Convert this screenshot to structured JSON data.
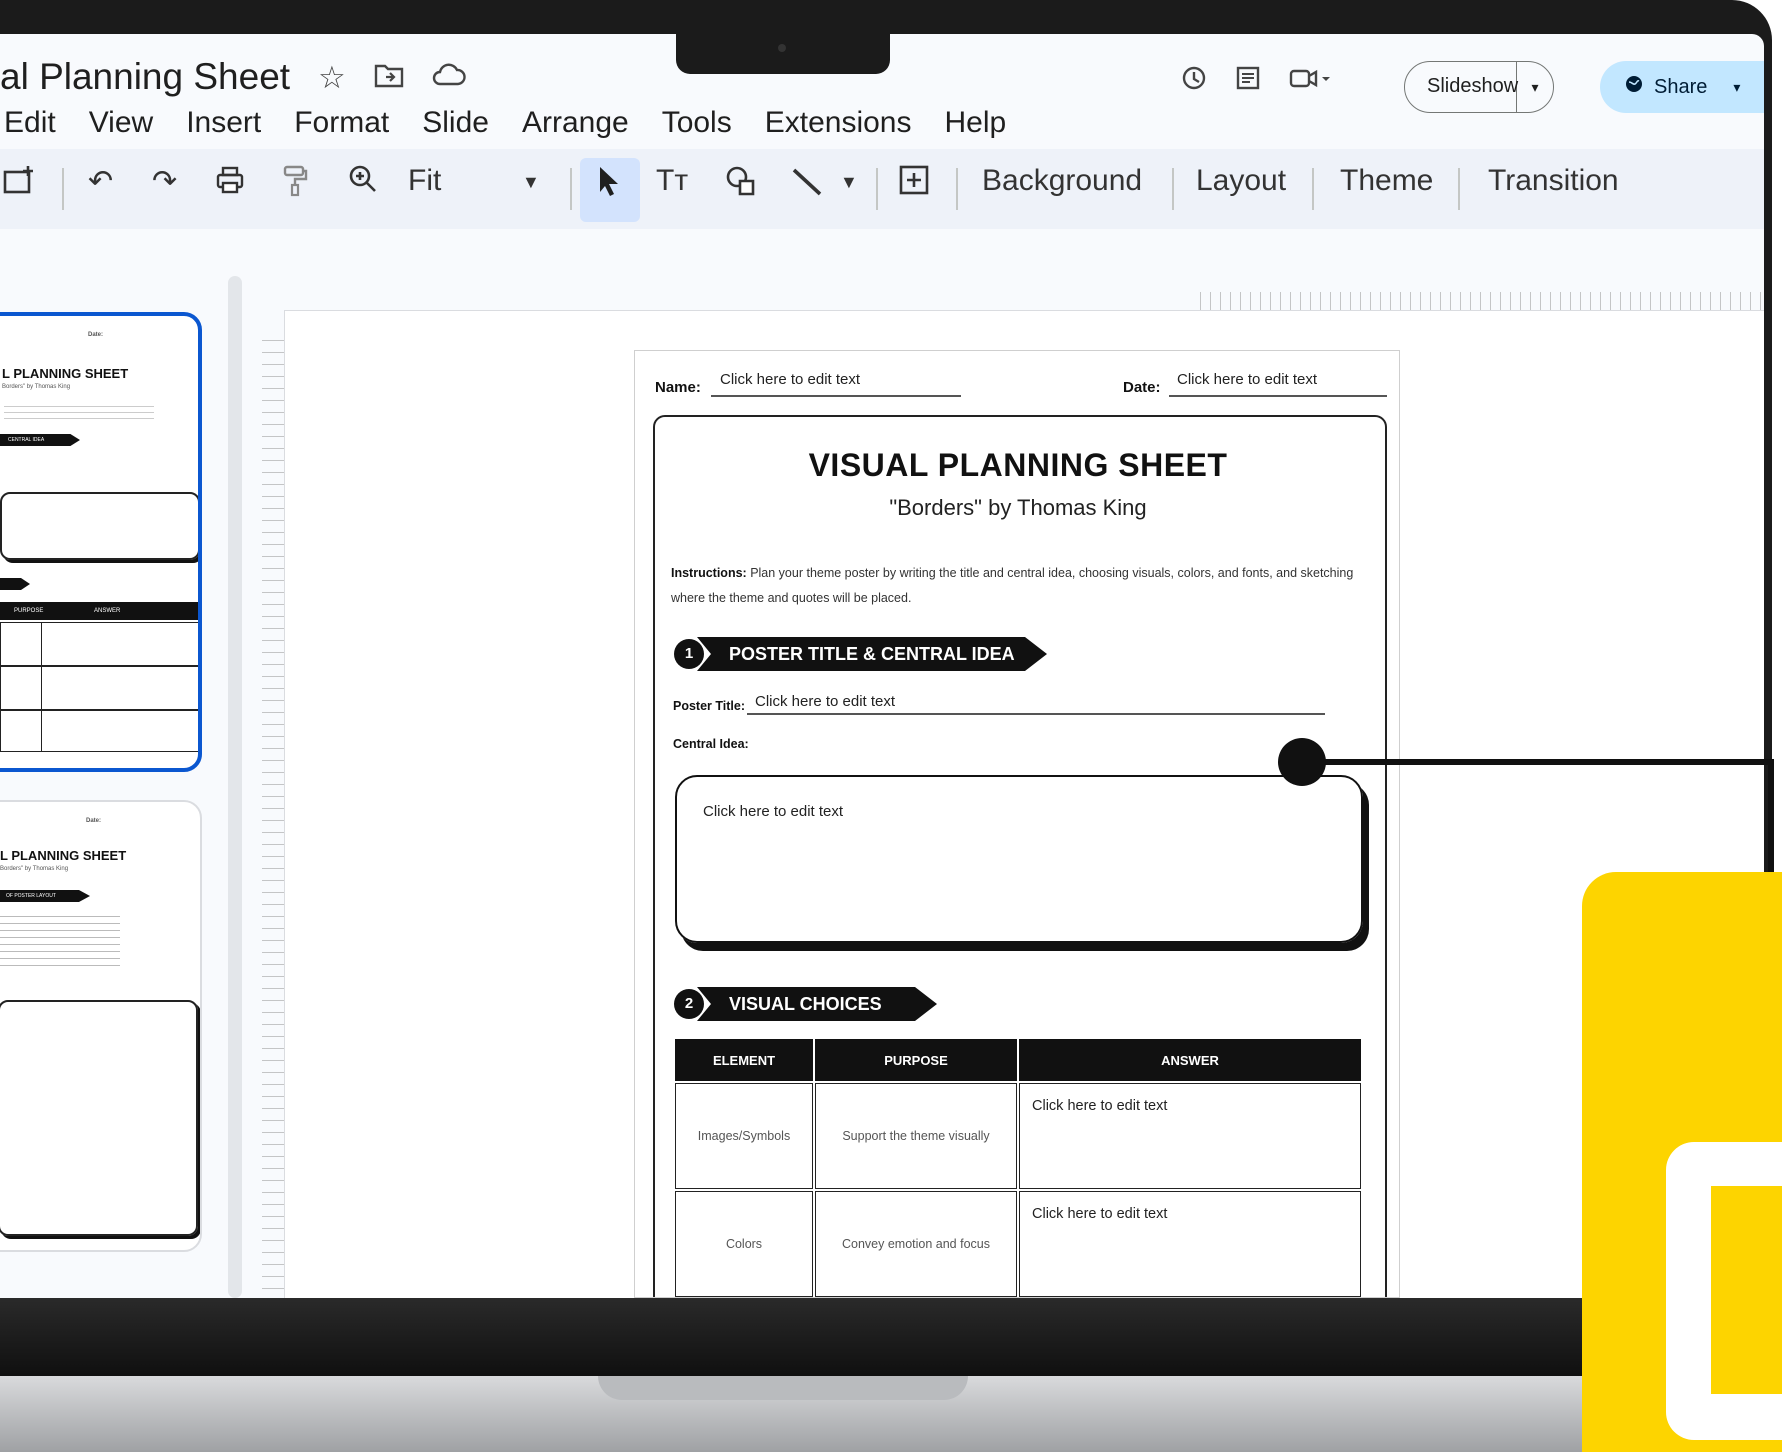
{
  "document_title": "al Planning Sheet",
  "menu": [
    "Edit",
    "View",
    "Insert",
    "Format",
    "Slide",
    "Arrange",
    "Tools",
    "Extensions",
    "Help"
  ],
  "title_icons": [
    "star-icon",
    "move-to-folder-icon",
    "cloud-status-icon"
  ],
  "top_right": {
    "icons": [
      "history-icon",
      "comments-icon",
      "meet-icon"
    ],
    "slideshow_label": "Slideshow",
    "share_label": "Share"
  },
  "toolbar": {
    "zoom_label": "Fit",
    "text_tool": "Tт",
    "background": "Background",
    "layout": "Layout",
    "theme": "Theme",
    "transition": "Transition"
  },
  "filmstrip": {
    "slide1": {
      "title": "L PLANNING SHEET",
      "date": "Date:",
      "subtitle": "Borders\" by Thomas King",
      "banner": "CENTRAL IDEA",
      "col1": "PURPOSE",
      "col2": "ANSWER"
    },
    "slide2": {
      "title": "L PLANNING SHEET",
      "date": "Date:",
      "subtitle": "Borders\" by Thomas King",
      "banner": "OF POSTER LAYOUT"
    }
  },
  "sheet": {
    "name_label": "Name:",
    "name_value": "Click here to edit text",
    "date_label": "Date:",
    "date_value": "Click here to edit text",
    "title": "VISUAL PLANNING SHEET",
    "subtitle": "\"Borders\" by Thomas King",
    "instructions_label": "Instructions:",
    "instructions_text": "Plan your theme poster by writing the title and central idea, choosing visuals, colors, and fonts, and sketching where the theme and quotes will be placed.",
    "section1_num": "1",
    "section1_title": "POSTER TITLE & CENTRAL IDEA",
    "poster_title_label": "Poster Title:",
    "poster_title_value": "Click here to edit text",
    "central_idea_label": "Central Idea:",
    "central_idea_value": "Click here to edit text",
    "section2_num": "2",
    "section2_title": "VISUAL CHOICES",
    "table": {
      "headers": [
        "ELEMENT",
        "PURPOSE",
        "ANSWER"
      ],
      "rows": [
        {
          "element": "Images/Symbols",
          "purpose": "Support the theme visually",
          "answer": "Click here to edit text"
        },
        {
          "element": "Colors",
          "purpose": "Convey emotion and focus",
          "answer": "Click here to edit text"
        }
      ]
    }
  },
  "colors": {
    "accent_blue": "#0b57d0",
    "share_bg": "#c2e7ff",
    "brand_yellow": "#fdd400"
  }
}
